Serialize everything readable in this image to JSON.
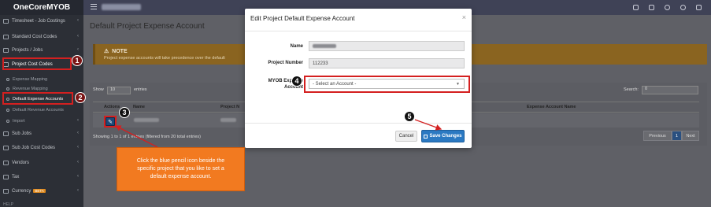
{
  "app": {
    "brand": "OneCoreMYOB"
  },
  "sidebar": {
    "items": [
      {
        "label": "Timesheet - Job Costings"
      },
      {
        "label": "Standard Cost Codes"
      },
      {
        "label": "Projects / Jobs"
      },
      {
        "label": "Project Cost Codes"
      },
      {
        "label": "Expense Mapping"
      },
      {
        "label": "Revenue Mapping"
      },
      {
        "label": "Default Expense Accounts"
      },
      {
        "label": "Default Revenue Accounts"
      },
      {
        "label": "Import"
      },
      {
        "label": "Sub Jobs"
      },
      {
        "label": "Sub Job Cost Codes"
      },
      {
        "label": "Vendors"
      },
      {
        "label": "Tax"
      },
      {
        "label": "Currency",
        "badge": "BETA"
      },
      {
        "label": "HELP"
      }
    ]
  },
  "page": {
    "title": "Default Project Expense Account",
    "note_title": "NOTE",
    "note_text": "Project expense accounts will take precedence over the default",
    "show_label": "Show",
    "show_value": "10",
    "entries_label": "entries",
    "search_label": "Search:",
    "search_value": "0",
    "columns": {
      "actions": "Actions",
      "name": "Name",
      "project_number": "Project N",
      "expense_account_name": "Expense Account Name"
    },
    "showing": "Showing 1 to 1 of 1 entries (filtered from 20 total entries)",
    "pager": {
      "previous": "Previous",
      "current": "1",
      "next": "Next"
    }
  },
  "modal": {
    "title": "Edit Project Default Expense Account",
    "close": "×",
    "name_label": "Name",
    "project_number_label": "Project Number",
    "project_number_value": "112233",
    "account_label_line1": "MYOB Expense",
    "account_label_line2": "Account",
    "account_placeholder": "- Select an Account -",
    "cancel_label": "Cancel",
    "save_label": "Save Changes"
  },
  "annotations": {
    "step1": "1",
    "step2": "2",
    "step3": "3",
    "step4": "4",
    "step5": "5",
    "callout": "Click the blue pencil icon beside the specific project that you like to set a default expense account."
  },
  "colors": {
    "highlight": "#d42020",
    "callout": "#f27a20",
    "save_button": "#2b79c2",
    "note_banner": "#8a6420"
  }
}
